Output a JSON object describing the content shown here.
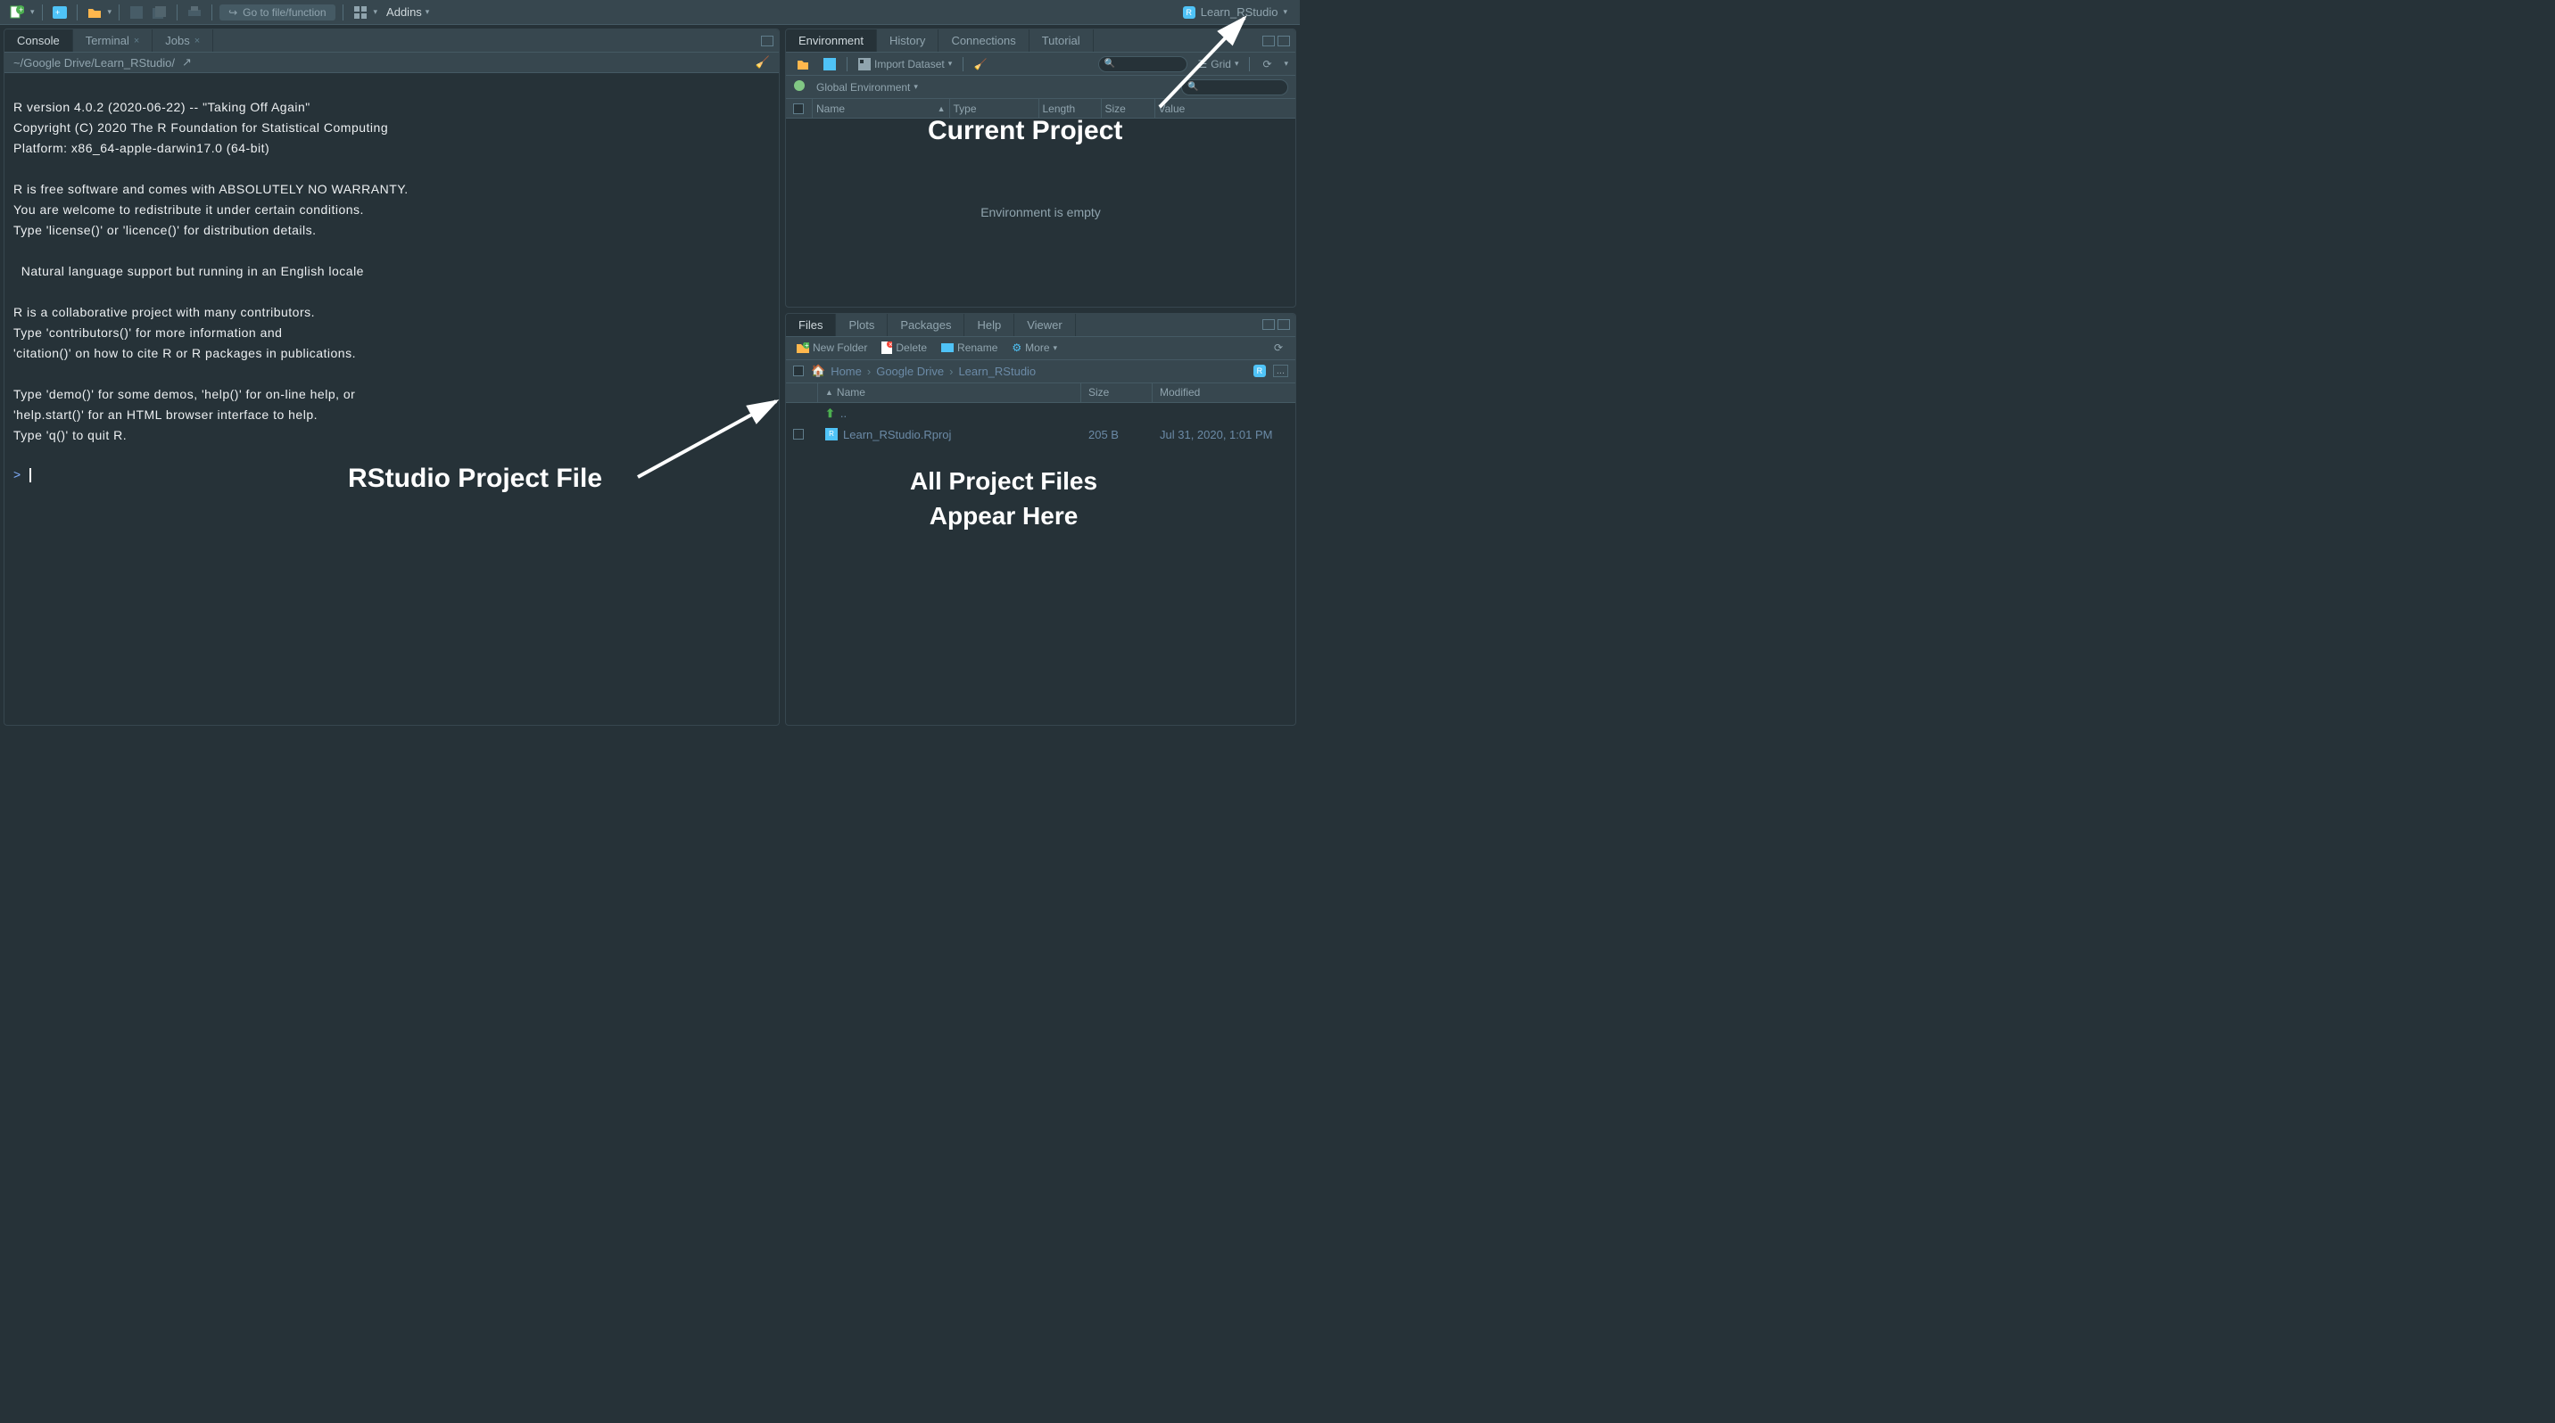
{
  "toolbar": {
    "goto_placeholder": "Go to file/function",
    "addins_label": "Addins",
    "project_name": "Learn_RStudio"
  },
  "console": {
    "tabs": [
      "Console",
      "Terminal",
      "Jobs"
    ],
    "path": "~/Google Drive/Learn_RStudio/",
    "text": "R version 4.0.2 (2020-06-22) -- \"Taking Off Again\"\nCopyright (C) 2020 The R Foundation for Statistical Computing\nPlatform: x86_64-apple-darwin17.0 (64-bit)\n\nR is free software and comes with ABSOLUTELY NO WARRANTY.\nYou are welcome to redistribute it under certain conditions.\nType 'license()' or 'licence()' for distribution details.\n\n  Natural language support but running in an English locale\n\nR is a collaborative project with many contributors.\nType 'contributors()' for more information and\n'citation()' on how to cite R or R packages in publications.\n\nType 'demo()' for some demos, 'help()' for on-line help, or\n'help.start()' for an HTML browser interface to help.\nType 'q()' to quit R.\n",
    "prompt": ">"
  },
  "environment": {
    "tabs": [
      "Environment",
      "History",
      "Connections",
      "Tutorial"
    ],
    "import_label": "Import Dataset",
    "scope_label": "Global Environment",
    "view_mode": "Grid",
    "columns": [
      "Name",
      "Type",
      "Length",
      "Size",
      "Value"
    ],
    "empty_text": "Environment is empty"
  },
  "files": {
    "tabs": [
      "Files",
      "Plots",
      "Packages",
      "Help",
      "Viewer"
    ],
    "new_folder": "New Folder",
    "delete": "Delete",
    "rename": "Rename",
    "more": "More",
    "breadcrumb": [
      "Home",
      "Google Drive",
      "Learn_RStudio"
    ],
    "columns": [
      "Name",
      "Size",
      "Modified"
    ],
    "rows": [
      {
        "name": "..",
        "icon": "up",
        "size": "",
        "modified": ""
      },
      {
        "name": "Learn_RStudio.Rproj",
        "icon": "rproj",
        "size": "205 B",
        "modified": "Jul 31, 2020, 1:01 PM"
      }
    ]
  },
  "annotations": {
    "current_project": "Current Project",
    "project_file": "RStudio Project File",
    "files_here_1": "All Project Files",
    "files_here_2": "Appear Here"
  }
}
